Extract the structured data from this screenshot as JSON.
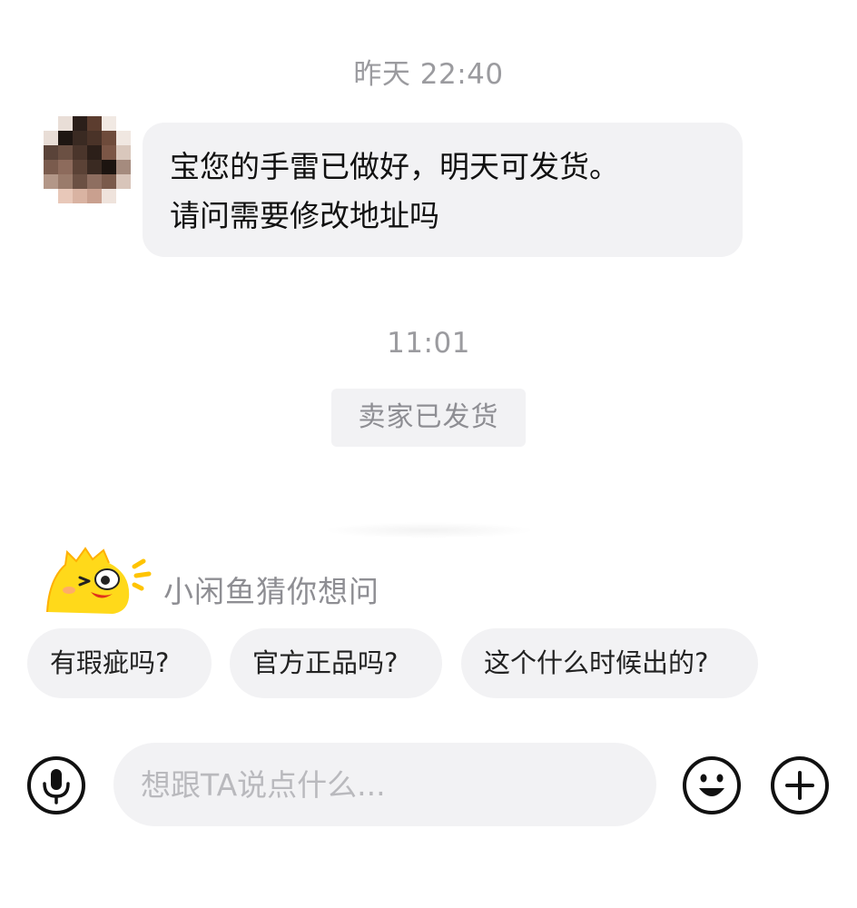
{
  "chat": {
    "timestamps": [
      "昨天 22:40",
      "11:01"
    ],
    "message": {
      "lines": [
        "宝您的手雷已做好，明天可发货。",
        "请问需要修改地址吗"
      ]
    },
    "status_notice": "卖家已发货"
  },
  "suggestions": {
    "title": "小闲鱼猜你想问",
    "mascot_icon": "fish-mascot-icon",
    "questions": [
      "有瑕疵吗?",
      "官方正品吗?",
      "这个什么时候出的?"
    ]
  },
  "composer": {
    "placeholder": "想跟TA说点什么...",
    "voice_icon": "microphone-icon",
    "emoji_icon": "smiley-icon",
    "more_icon": "plus-icon"
  },
  "colors": {
    "bubble_bg": "#f2f2f4",
    "muted_text": "#9b9b9f",
    "mascot_yellow": "#ffd91a",
    "mascot_orange": "#ff9a1f"
  }
}
